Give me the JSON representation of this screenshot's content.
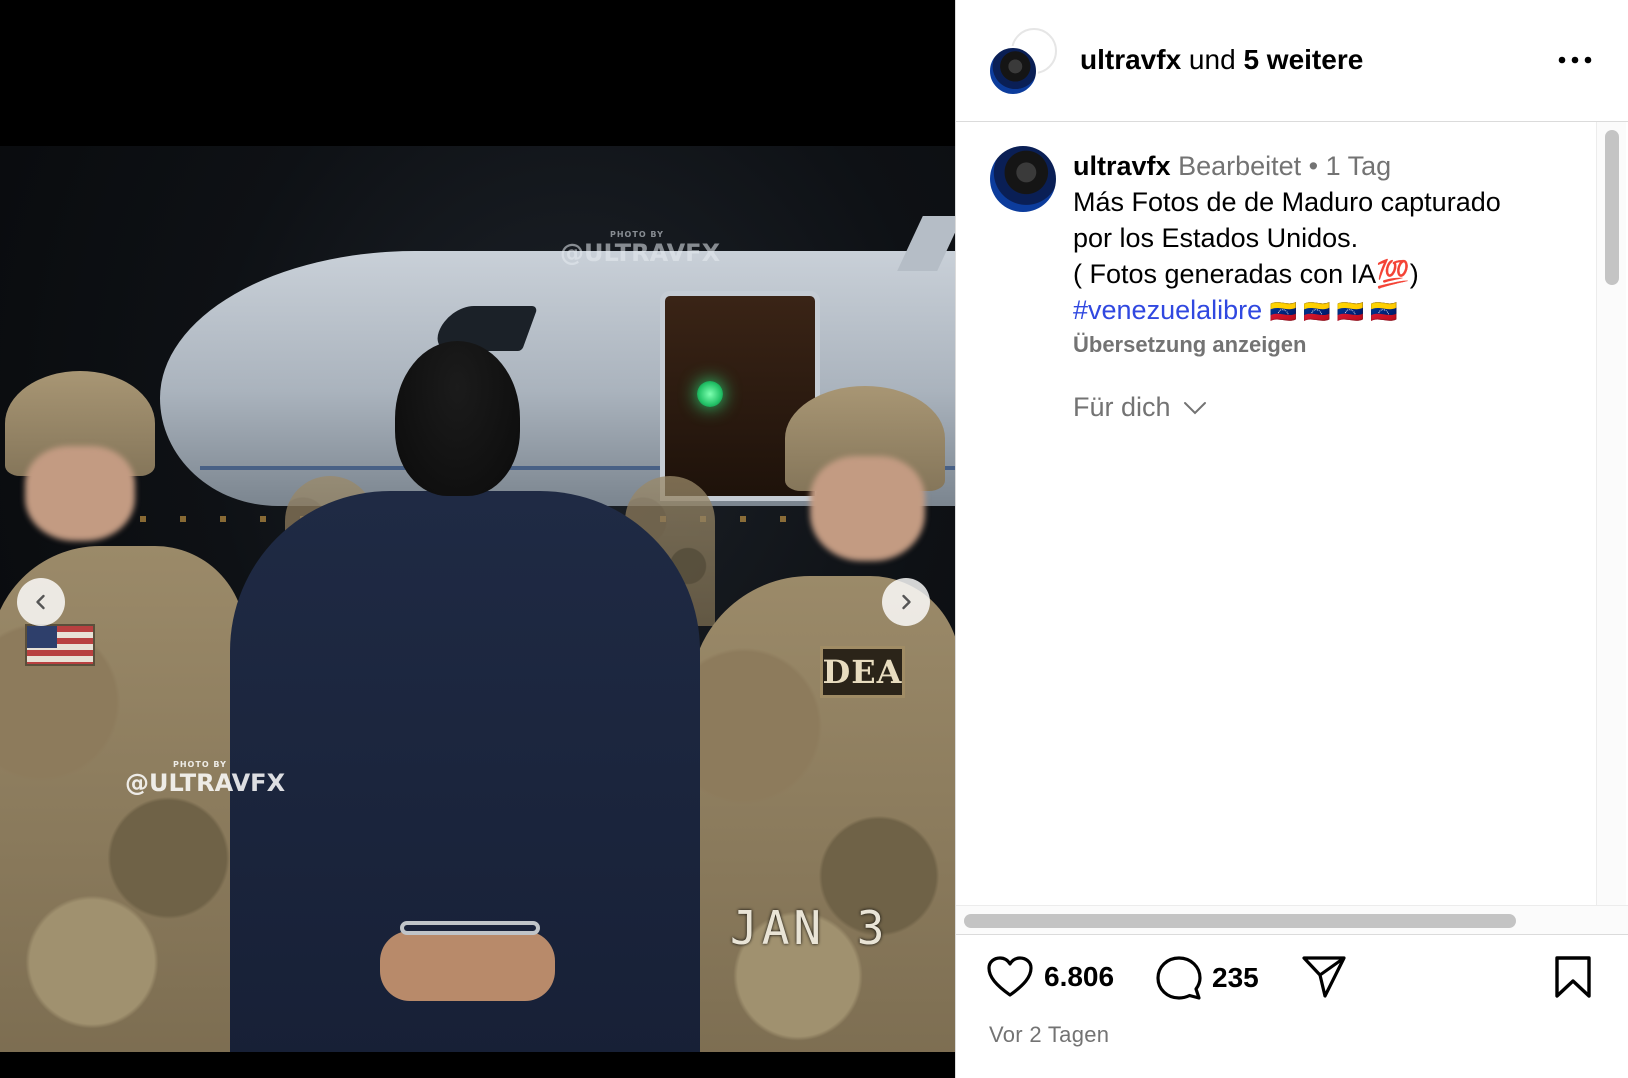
{
  "media": {
    "watermark_top_small": "PHOTO BY",
    "watermark_top": "@ULTRAVFX",
    "watermark_bottom_small": "PHOTO BY",
    "watermark_bottom": "@ULTRAVFX",
    "patch_text": "DEA",
    "date_stamp": "JAN  3",
    "prev_icon": "chevron-left-icon",
    "next_icon": "chevron-right-icon"
  },
  "header": {
    "username": "ultravfx",
    "joiner": " und ",
    "others": "5 weitere",
    "more_icon": "more-icon"
  },
  "post": {
    "username": "ultravfx",
    "edited": "Bearbeitet",
    "dot": " • ",
    "age": "1 Tag",
    "caption_line1": "Más Fotos de de Maduro capturado",
    "caption_line2": "por los Estados Unidos.",
    "caption_line3": "( Fotos generadas con IA💯)",
    "hashtag": "#venezuelalibre",
    "flags": "🇻🇪 🇻🇪 🇻🇪 🇻🇪",
    "translate": "Übersetzung anzeigen"
  },
  "feed_filter": {
    "label": "Für dich",
    "icon": "chevron-down-icon"
  },
  "actions": {
    "like_count": "6.806",
    "comment_count": "235",
    "icons": [
      "heart-icon",
      "comment-icon",
      "share-icon",
      "bookmark-icon"
    ]
  },
  "timestamp": "Vor 2 Tagen",
  "colors": {
    "hashtag": "#3048e0",
    "secondary_text": "#737373",
    "border": "#dbdbdb"
  }
}
